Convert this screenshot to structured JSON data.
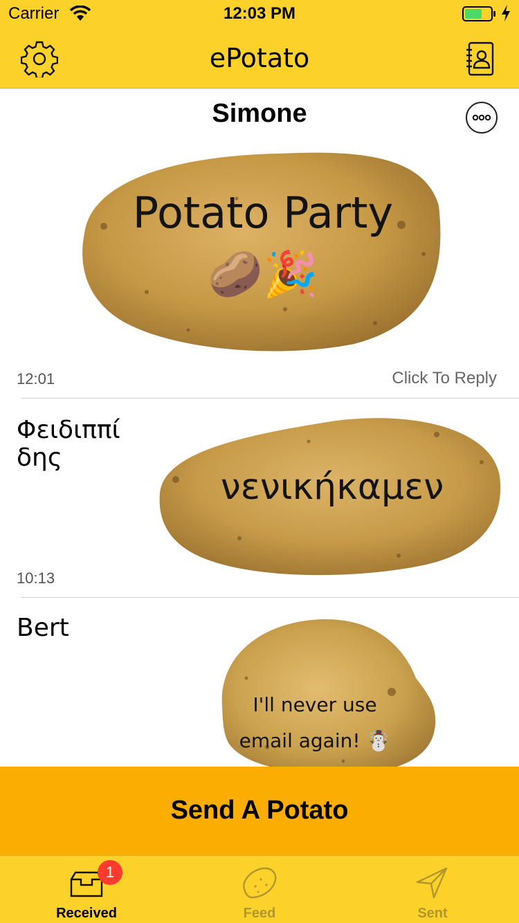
{
  "status_bar": {
    "carrier": "Carrier",
    "time": "12:03 PM",
    "battery_color": "#4cd964"
  },
  "nav": {
    "title": "ePotato",
    "left_icon": "gear-icon",
    "right_icon": "contacts-book-icon"
  },
  "messages": [
    {
      "sender": "Simone",
      "potato_text": "Potato Party",
      "emoji": "🥔🎉",
      "time": "12:01",
      "reply_label": "Click To Reply",
      "more_icon": "more-options-icon"
    },
    {
      "sender": "Φειδιππί\nδης",
      "potato_text": "νενικήκαμεν",
      "time": "10:13"
    },
    {
      "sender": "Bert",
      "potato_text_line1": "I'll never use",
      "potato_text_line2": "email again! ☃️"
    }
  ],
  "send_button": {
    "label": "Send A Potato",
    "color": "#fbad02"
  },
  "tabs": [
    {
      "label": "Received",
      "icon": "inbox-tray-icon",
      "badge": "1",
      "active": true
    },
    {
      "label": "Feed",
      "icon": "potato-icon",
      "active": false
    },
    {
      "label": "Sent",
      "icon": "paper-plane-icon",
      "active": false
    }
  ],
  "colors": {
    "brand_yellow": "#fcd22a",
    "accent_orange": "#fbad02",
    "badge_red": "#ff3b30"
  }
}
